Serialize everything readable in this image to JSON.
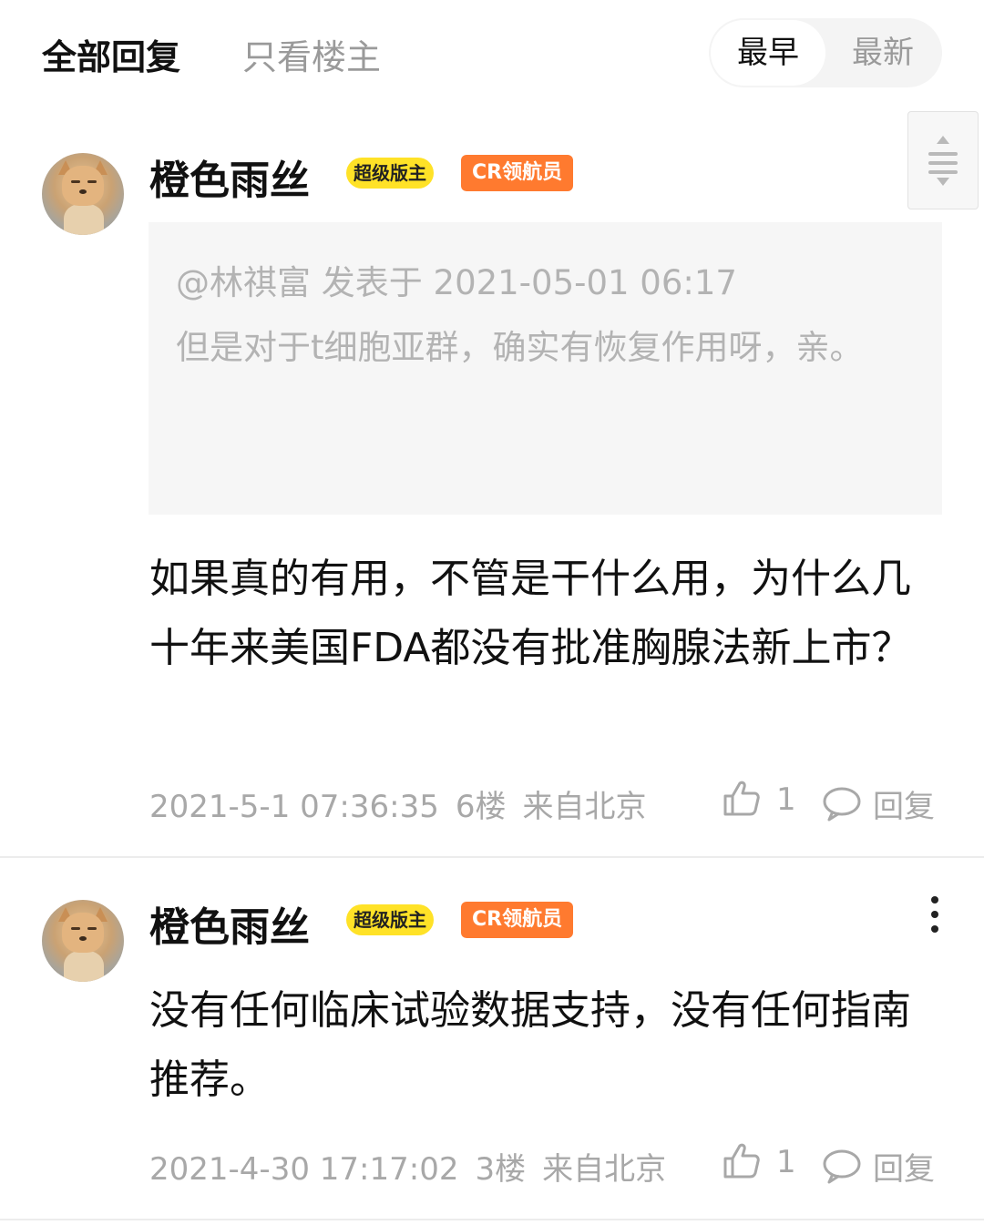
{
  "header": {
    "tab_all": "全部回复",
    "tab_op_only": "只看楼主",
    "sort_earliest": "最早",
    "sort_latest": "最新"
  },
  "comments": [
    {
      "username": "橙色雨丝",
      "badge_mod": "超级版主",
      "badge_cr": "CR领航员",
      "quote": {
        "header": "@林祺富 发表于 2021-05-01 06:17",
        "text": "但是对于t细胞亚群，确实有恢复作用呀，亲。"
      },
      "body": "如果真的有用，不管是干什么用，为什么几十年来美国FDA都没有批准胸腺法新上市？",
      "timestamp": "2021-5-1 07:36:35",
      "floor": "6楼",
      "location": "来自北京",
      "likes": "1",
      "reply_label": "回复"
    },
    {
      "username": "橙色雨丝",
      "badge_mod": "超级版主",
      "badge_cr": "CR领航员",
      "body": "没有任何临床试验数据支持，没有任何指南推荐。",
      "timestamp": "2021-4-30 17:17:02",
      "floor": "3楼",
      "location": "来自北京",
      "likes": "1",
      "reply_label": "回复"
    }
  ],
  "colors": {
    "badge_mod_bg": "#ffe227",
    "badge_cr_bg": "#ff7a2f",
    "meta_gray": "#a8a8a8"
  },
  "icons": [
    "sort-scroll-icon",
    "avatar",
    "thumbs-up-icon",
    "comment-bubble-icon",
    "more-vertical-icon"
  ]
}
